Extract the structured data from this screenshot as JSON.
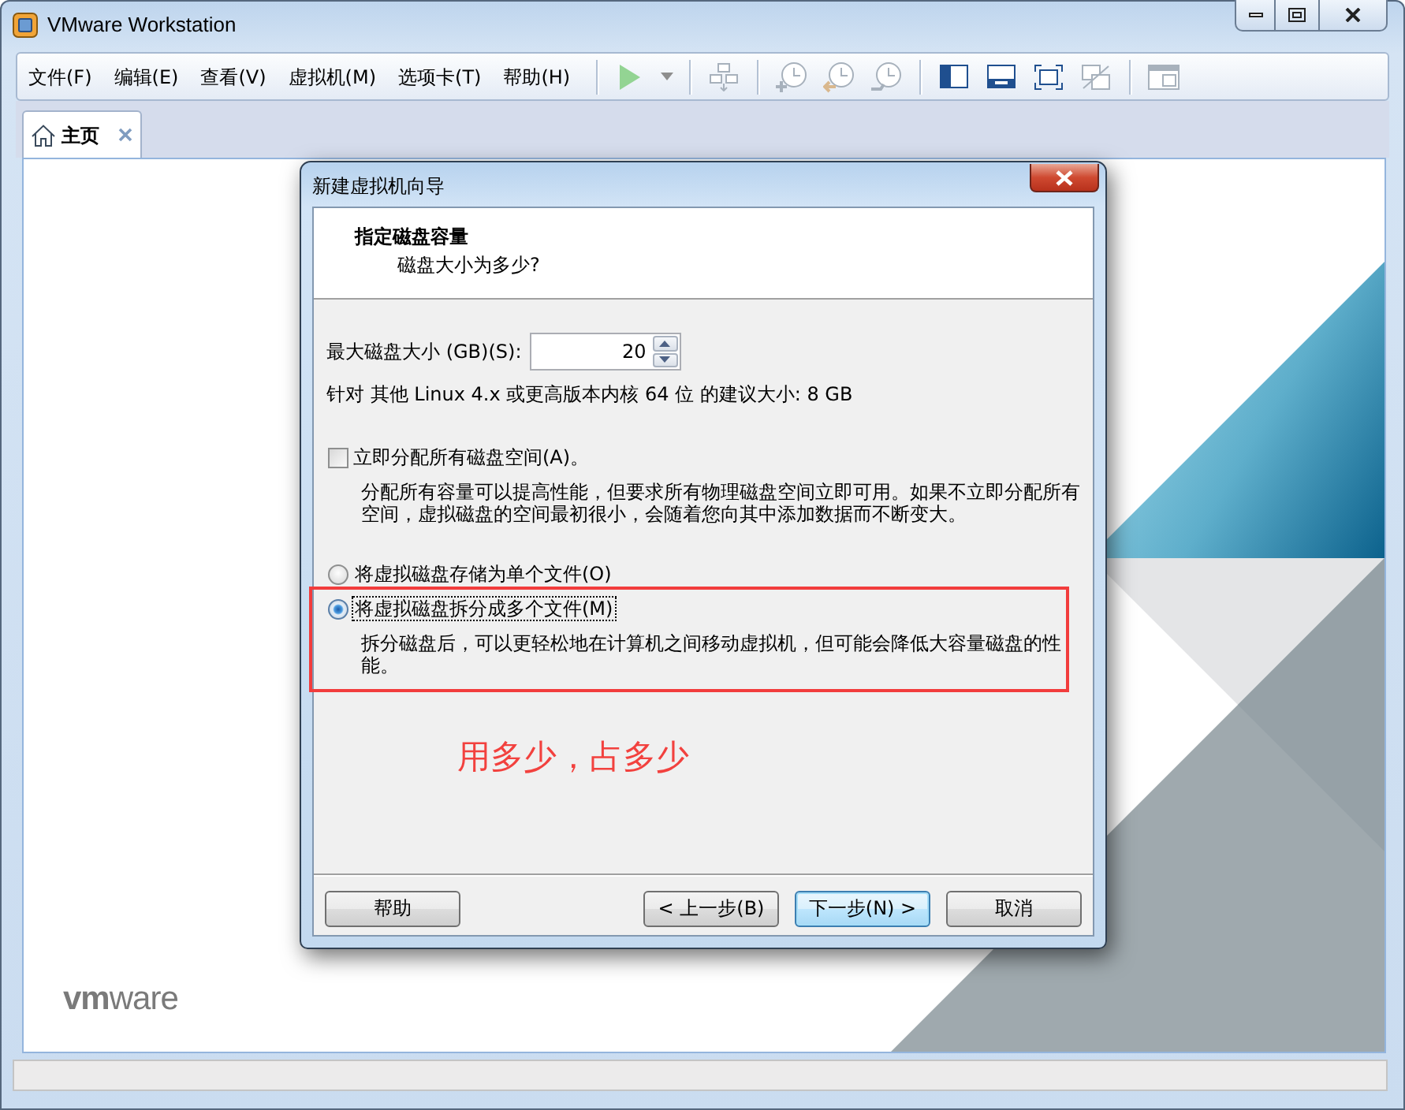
{
  "window": {
    "title": "VMware Workstation"
  },
  "menu": [
    "文件(F)",
    "编辑(E)",
    "查看(V)",
    "虚拟机(M)",
    "选项卡(T)",
    "帮助(H)"
  ],
  "toolbar": {
    "groups": [
      {
        "items": [
          {
            "kind": "play",
            "disabled": true
          },
          {
            "kind": "dropdown",
            "disabled": true
          }
        ]
      },
      {
        "items": [
          {
            "kind": "send-keys",
            "disabled": true
          }
        ]
      },
      {
        "items": [
          {
            "kind": "snapshot-take",
            "disabled": true
          },
          {
            "kind": "snapshot-revert",
            "disabled": true
          },
          {
            "kind": "snapshot-manager",
            "disabled": true
          }
        ]
      },
      {
        "items": [
          {
            "kind": "library",
            "disabled": false
          },
          {
            "kind": "console",
            "disabled": false
          },
          {
            "kind": "fullscreen",
            "disabled": false
          },
          {
            "kind": "unity",
            "disabled": true
          }
        ]
      },
      {
        "items": [
          {
            "kind": "thumbnail",
            "disabled": true
          }
        ]
      }
    ]
  },
  "tabs": [
    {
      "label": "主页",
      "selected": true
    }
  ],
  "home": {
    "logo": "**vm**ware"
  },
  "dialog": {
    "title": "新建虚拟机向导",
    "heading": "指定磁盘容量",
    "subheading": "磁盘大小为多少?",
    "size_field": {
      "label": "最大磁盘大小 (GB)(S):",
      "value": "20"
    },
    "recommendation": "针对 其他 Linux 4.x 或更高版本内核 64 位 的建议大小: 8 GB",
    "allocate": {
      "label": "立即分配所有磁盘空间(A)。",
      "checked": false,
      "description": "分配所有容量可以提高性能，但要求所有物理磁盘空间立即可用。如果不立即分配所有空间，虚拟磁盘的空间最初很小，会随着您向其中添加数据而不断变大。"
    },
    "storage_options": [
      {
        "label": "将虚拟磁盘存储为单个文件(O)",
        "selected": false,
        "focused": false,
        "highlighted": false
      },
      {
        "label": "将虚拟磁盘拆分成多个文件(M)",
        "selected": true,
        "focused": true,
        "highlighted": true,
        "description": "拆分磁盘后，可以更轻松地在计算机之间移动虚拟机，但可能会降低大容量磁盘的性能。"
      }
    ],
    "footer": {
      "left": [
        {
          "label": "帮助",
          "default": false
        }
      ],
      "right": [
        {
          "label": "< 上一步(B)",
          "default": false
        },
        {
          "label": "下一步(N) >",
          "default": true
        },
        {
          "label": "取消",
          "default": false
        }
      ]
    }
  },
  "annotation": {
    "text": "用多少，占多少"
  }
}
